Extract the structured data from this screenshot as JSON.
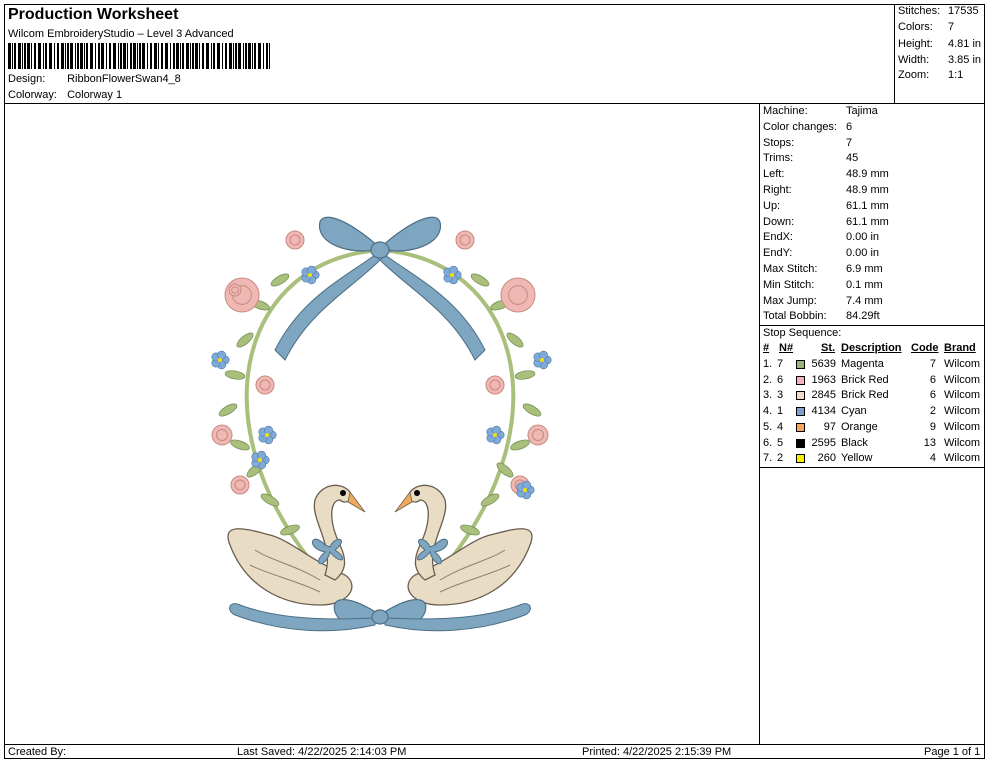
{
  "header": {
    "title": "Production Worksheet",
    "subtitle": "Wilcom EmbroideryStudio – Level 3 Advanced",
    "design_label": "Design:",
    "design_value": "RibbonFlowerSwan4_8",
    "colorway_label": "Colorway:",
    "colorway_value": "Colorway 1"
  },
  "stats": [
    {
      "label": "Stitches:",
      "value": "17535"
    },
    {
      "label": "Colors:",
      "value": "7"
    },
    {
      "label": "Height:",
      "value": "4.81 in"
    },
    {
      "label": "Width:",
      "value": "3.85 in"
    },
    {
      "label": "Zoom:",
      "value": "1:1"
    }
  ],
  "machine": [
    {
      "label": "Machine:",
      "value": "Tajima"
    },
    {
      "label": "Color changes:",
      "value": "6"
    },
    {
      "label": "Stops:",
      "value": "7"
    },
    {
      "label": "Trims:",
      "value": "45"
    },
    {
      "label": "Left:",
      "value": "48.9 mm"
    },
    {
      "label": "Right:",
      "value": "48.9 mm"
    },
    {
      "label": "Up:",
      "value": "61.1 mm"
    },
    {
      "label": "Down:",
      "value": "61.1 mm"
    },
    {
      "label": "EndX:",
      "value": "0.00 in"
    },
    {
      "label": "EndY:",
      "value": "0.00 in"
    },
    {
      "label": "Max Stitch:",
      "value": "6.9 mm"
    },
    {
      "label": "Min Stitch:",
      "value": "0.1 mm"
    },
    {
      "label": "Max Jump:",
      "value": "7.4 mm"
    },
    {
      "label": "Total Bobbin:",
      "value": "84.29ft"
    }
  ],
  "stop_sequence": {
    "title": "Stop Sequence:",
    "columns": {
      "num": "#",
      "n": "N#",
      "st": "St.",
      "desc": "Description",
      "code": "Code",
      "brand": "Brand"
    },
    "rows": [
      {
        "num": "1.",
        "n": "7",
        "color": "#9bb37a",
        "st": "5639",
        "desc": "Magenta",
        "code": "7",
        "brand": "Wilcom"
      },
      {
        "num": "2.",
        "n": "6",
        "color": "#f2b3bf",
        "st": "1963",
        "desc": "Brick Red",
        "code": "6",
        "brand": "Wilcom"
      },
      {
        "num": "3.",
        "n": "3",
        "color": "#f3d9cc",
        "st": "2845",
        "desc": "Brick Red",
        "code": "6",
        "brand": "Wilcom"
      },
      {
        "num": "4.",
        "n": "1",
        "color": "#7f9fcf",
        "st": "4134",
        "desc": "Cyan",
        "code": "2",
        "brand": "Wilcom"
      },
      {
        "num": "5.",
        "n": "4",
        "color": "#f5a55c",
        "st": "97",
        "desc": "Orange",
        "code": "9",
        "brand": "Wilcom"
      },
      {
        "num": "6.",
        "n": "5",
        "color": "#000000",
        "st": "2595",
        "desc": "Black",
        "code": "13",
        "brand": "Wilcom"
      },
      {
        "num": "7.",
        "n": "2",
        "color": "#f7f000",
        "st": "260",
        "desc": "Yellow",
        "code": "4",
        "brand": "Wilcom"
      }
    ]
  },
  "footer": {
    "created_by": "Created By:",
    "last_saved": "Last Saved: 4/22/2025 2:14:03 PM",
    "printed": "Printed: 4/22/2025 2:15:39 PM",
    "page": "Page 1 of 1"
  },
  "design_colors": {
    "ribbon": "#7fa6c0",
    "leaf": "#a9bf7c",
    "rose": "#efb8b3",
    "swan": "#e8dcc4",
    "beak": "#f0a85a",
    "forget_me_not": "#7fa9d6",
    "center": "#f3e300"
  }
}
